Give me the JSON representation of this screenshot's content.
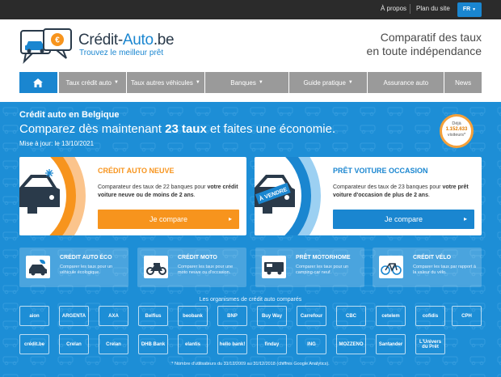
{
  "topbar": {
    "about": "À propos",
    "sitemap": "Plan du site",
    "language": "FR"
  },
  "header": {
    "brand_part1": "Crédit-",
    "brand_part2": "Auto",
    "brand_part3": ".be",
    "tagline": "Trouvez le meilleur prêt",
    "slogan_line1": "Comparatif des taux",
    "slogan_line2": "en toute indépendance"
  },
  "nav": {
    "items": [
      {
        "label": "Taux crédit auto",
        "has_caret": true
      },
      {
        "label": "Taux autres véhicules",
        "has_caret": true
      },
      {
        "label": "Banques",
        "has_caret": true
      },
      {
        "label": "Guide pratique",
        "has_caret": true
      },
      {
        "label": "Assurance auto",
        "has_caret": false
      },
      {
        "label": "News",
        "has_caret": false
      }
    ]
  },
  "hero": {
    "subtitle": "Crédit auto en Belgique",
    "headline_pre": "Comparez dès maintenant ",
    "headline_bold": "23 taux",
    "headline_post": " et faites une économie.",
    "update": "Mise à jour: le 13/10/2021",
    "badge_line1": "Déjà",
    "badge_number": "1.152.633",
    "badge_line2": "visiteurs*"
  },
  "cards": [
    {
      "title": "CRÉDIT AUTO NEUVE",
      "desc_pre": "Comparateur des taux de 22 banques pour ",
      "desc_bold": "votre crédit voiture neuve ou de moins de 2 ans",
      "desc_post": ".",
      "button": "Je compare",
      "color": "#f7941d"
    },
    {
      "title": "PRÊT VOITURE OCCASION",
      "desc_pre": "Comparateur des taux de 23 banques pour ",
      "desc_bold": "votre prêt voiture d'occasion de plus de 2 ans",
      "desc_post": ".",
      "button": "Je compare",
      "sticker": "À VENDRE",
      "color": "#1a86d0"
    }
  ],
  "small_cards": [
    {
      "title": "CRÉDIT AUTO ÉCO",
      "desc": "Comparer les taux pour un véhicule écologique."
    },
    {
      "title": "CRÉDIT MOTO",
      "desc": "Comparer les taux pour une moto neuve ou d'occasion."
    },
    {
      "title": "PRÊT MOTORHOME",
      "desc": "Comparer les taux pour un camping-car neuf."
    },
    {
      "title": "CRÉDIT VÉLO",
      "desc": "Comparer les taux par rapport à la valeur du vélo."
    }
  ],
  "partners": {
    "title": "Les organismes de crédit auto comparés",
    "row1": [
      "aion",
      "ARGENTA",
      "AXA",
      "Belfius",
      "beobank",
      "BNP",
      "Buy Way",
      "Carrefour",
      "CBC",
      "cetelem",
      "cofidis",
      "CPH"
    ],
    "row2": [
      "crédit.be",
      "Crelan",
      "Crelan",
      "DHB Bank",
      "elantis",
      "hello bank!",
      "finday",
      "ING",
      "MOZZENO",
      "Santander",
      "L'Univers du Prêt"
    ],
    "footnote": "* Nombre d'utilisateurs du 31/12/2009 au 31/12/2018 (chiffres Google Analytics)."
  },
  "colors": {
    "brand_blue": "#1a86d0",
    "brand_orange": "#f7941d",
    "nav_gray": "#9a9a9a",
    "topbar": "#2b2b2b"
  }
}
